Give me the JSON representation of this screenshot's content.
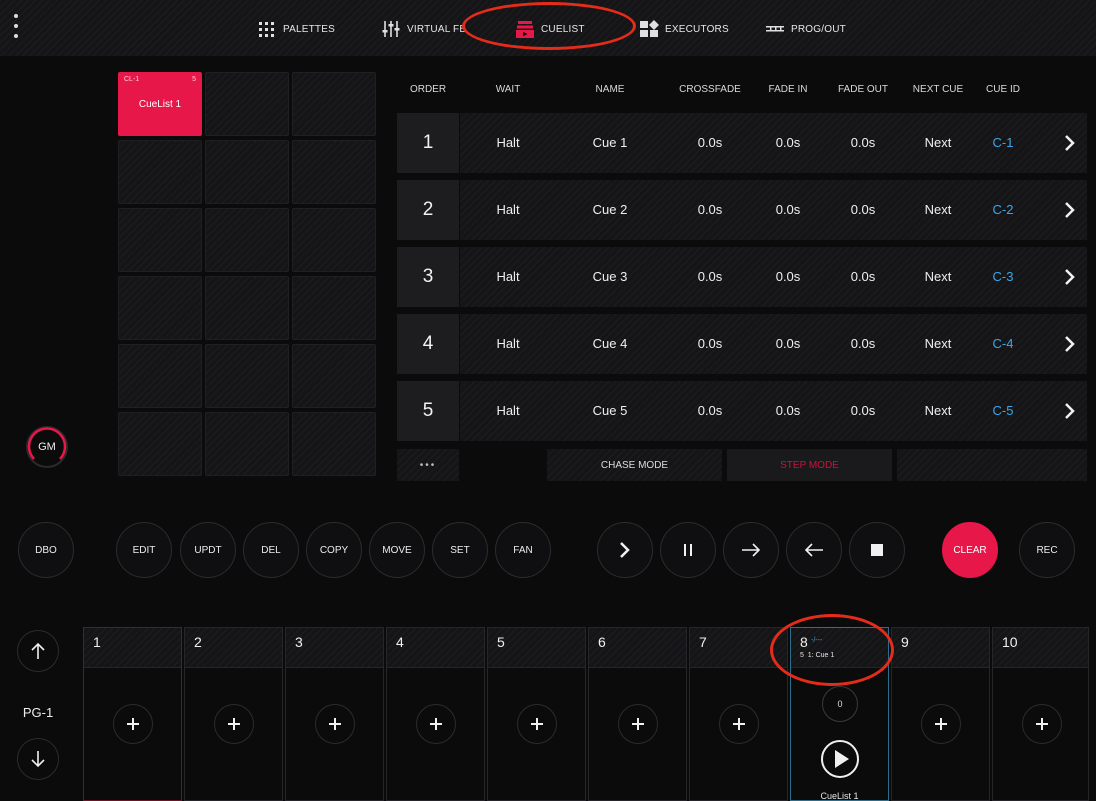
{
  "nav": {
    "palettes": "PALETTES",
    "virtual": "VIRTUAL FB",
    "cuelist": "CUELIST",
    "executors": "EXECUTORS",
    "progout": "PROG/OUT"
  },
  "pool": {
    "active_id": "CL-1",
    "active_num": "5",
    "active_label": "CueList 1"
  },
  "table": {
    "headers": [
      "ORDER",
      "WAIT",
      "NAME",
      "CROSSFADE",
      "FADE IN",
      "FADE OUT",
      "NEXT CUE",
      "CUE ID"
    ],
    "rows": [
      {
        "order": "1",
        "wait": "Halt",
        "name": "Cue 1",
        "crossfade": "0.0s",
        "fadein": "0.0s",
        "fadeout": "0.0s",
        "next": "Next",
        "id": "C-1"
      },
      {
        "order": "2",
        "wait": "Halt",
        "name": "Cue 2",
        "crossfade": "0.0s",
        "fadein": "0.0s",
        "fadeout": "0.0s",
        "next": "Next",
        "id": "C-2"
      },
      {
        "order": "3",
        "wait": "Halt",
        "name": "Cue 3",
        "crossfade": "0.0s",
        "fadein": "0.0s",
        "fadeout": "0.0s",
        "next": "Next",
        "id": "C-3"
      },
      {
        "order": "4",
        "wait": "Halt",
        "name": "Cue 4",
        "crossfade": "0.0s",
        "fadein": "0.0s",
        "fadeout": "0.0s",
        "next": "Next",
        "id": "C-4"
      },
      {
        "order": "5",
        "wait": "Halt",
        "name": "Cue 5",
        "crossfade": "0.0s",
        "fadein": "0.0s",
        "fadeout": "0.0s",
        "next": "Next",
        "id": "C-5"
      }
    ],
    "more": "•••",
    "chase_mode": "CHASE MODE",
    "step_mode": "STEP MODE"
  },
  "gm_label": "GM",
  "buttons": {
    "dbo": "DBO",
    "edit": "EDIT",
    "updt": "UPDT",
    "del": "DEL",
    "copy": "COPY",
    "move": "MOVE",
    "set": "SET",
    "fan": "FAN",
    "clear": "CLEAR",
    "rec": "REC"
  },
  "executors": {
    "page": "PG-1",
    "slots": [
      "1",
      "2",
      "3",
      "4",
      "5",
      "6",
      "7",
      "8",
      "9",
      "10"
    ],
    "active_slot": {
      "cue_num": "5",
      "cue_current": "1: Cue 1",
      "cue_mini": "-/---",
      "knob": "0",
      "name": "CueList 1"
    }
  },
  "colors": {
    "accent": "#e8174a",
    "cue_id": "#3da6e8",
    "step_mode": "#c8143c",
    "annotation": "#e52c1a"
  }
}
